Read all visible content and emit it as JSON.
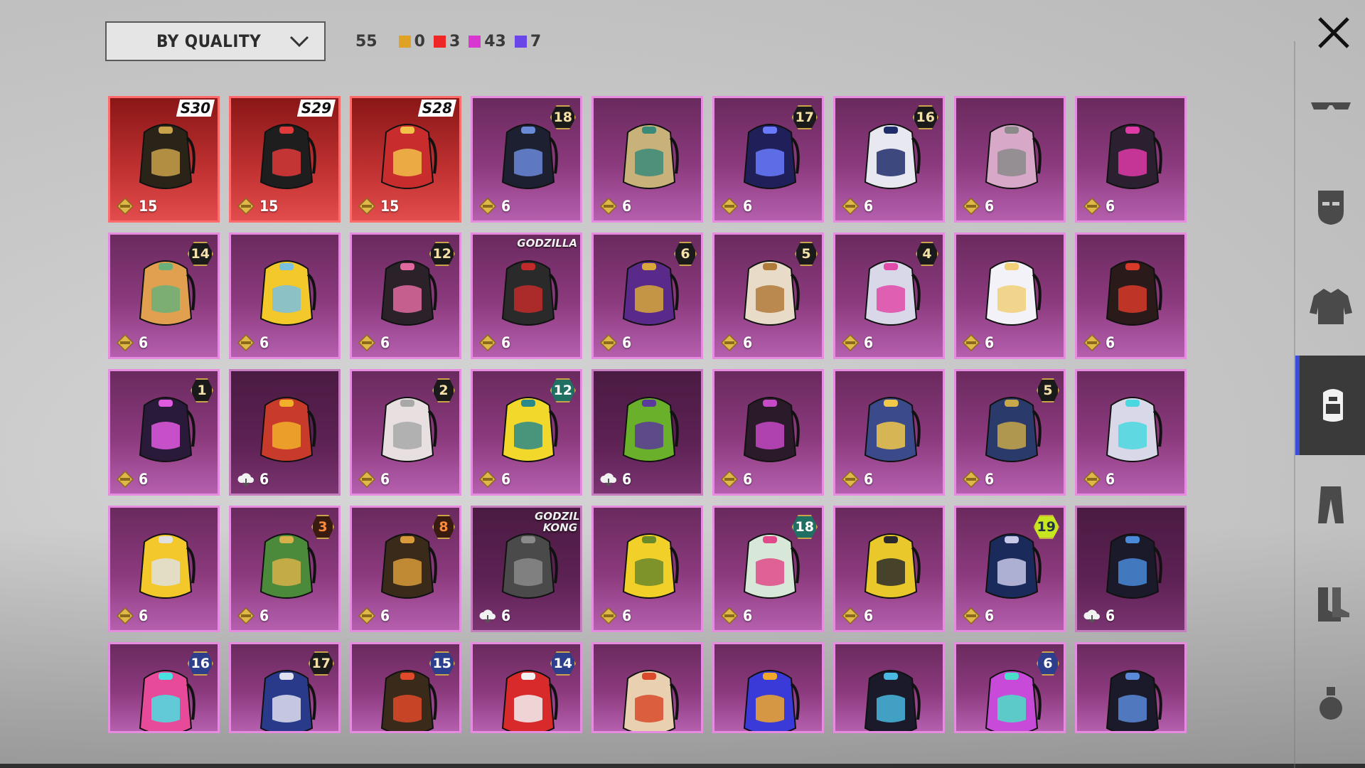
{
  "header": {
    "sort_label": "BY QUALITY",
    "total_count": "55",
    "counts": [
      {
        "color": "#e0a224",
        "value": "0"
      },
      {
        "color": "#ee2626",
        "value": "3"
      },
      {
        "color": "#d837d0",
        "value": "43"
      },
      {
        "color": "#6a46e8",
        "value": "7"
      }
    ]
  },
  "rail": {
    "categories": [
      "glasses-icon",
      "mask-icon",
      "jacket-icon",
      "backpack-icon",
      "pants-icon",
      "boots-icon",
      "grenade-icon"
    ],
    "active": "backpack-icon"
  },
  "items": [
    {
      "price": "15",
      "rarity": "red",
      "season": "S30",
      "color": "#2a2418",
      "accent": "#c9a14a",
      "currency": "diamond"
    },
    {
      "price": "15",
      "rarity": "red",
      "season": "S29",
      "color": "#1e1e1e",
      "accent": "#e03a3a",
      "currency": "diamond"
    },
    {
      "price": "15",
      "rarity": "red",
      "season": "S28",
      "color": "#c82c2c",
      "accent": "#f2c14a",
      "currency": "diamond"
    },
    {
      "price": "6",
      "rarity": "purple",
      "badge": "18",
      "color": "#1d2030",
      "accent": "#6a8ad8",
      "currency": "diamond"
    },
    {
      "price": "6",
      "rarity": "purple",
      "color": "#c8b27a",
      "accent": "#3a8a7a",
      "currency": "diamond"
    },
    {
      "price": "6",
      "rarity": "purple",
      "badge": "17",
      "color": "#1f1f5a",
      "accent": "#6a7aff",
      "currency": "diamond"
    },
    {
      "price": "6",
      "rarity": "purple",
      "badge": "16",
      "color": "#e8e8f0",
      "accent": "#1e2c6a",
      "currency": "diamond"
    },
    {
      "price": "6",
      "rarity": "purple",
      "color": "#d8a8c8",
      "accent": "#8a8a8a",
      "currency": "diamond"
    },
    {
      "price": "6",
      "rarity": "purple",
      "color": "#2a2030",
      "accent": "#e03aa8",
      "currency": "diamond"
    },
    {
      "price": "6",
      "rarity": "purple",
      "badge": "14",
      "color": "#e0a050",
      "accent": "#6ab07a",
      "currency": "diamond"
    },
    {
      "price": "6",
      "rarity": "purple",
      "color": "#f2c82a",
      "accent": "#7ac0e0",
      "currency": "diamond"
    },
    {
      "price": "6",
      "rarity": "purple",
      "badge": "12",
      "color": "#2a2228",
      "accent": "#e06aa0",
      "currency": "diamond"
    },
    {
      "price": "6",
      "rarity": "purple",
      "brand": "GODZILLA",
      "color": "#2a2a2a",
      "accent": "#c22a2a",
      "currency": "diamond"
    },
    {
      "price": "6",
      "rarity": "purple",
      "badge": "6",
      "color": "#5a2a8a",
      "accent": "#d8a83a",
      "currency": "diamond"
    },
    {
      "price": "6",
      "rarity": "purple",
      "badge": "5",
      "color": "#e8dcc8",
      "accent": "#b07a3a",
      "currency": "diamond"
    },
    {
      "price": "6",
      "rarity": "purple",
      "badge": "4",
      "color": "#d8d8e8",
      "accent": "#e04aa8",
      "currency": "diamond"
    },
    {
      "price": "6",
      "rarity": "purple",
      "color": "#f2f2f8",
      "accent": "#f2d07a",
      "currency": "diamond"
    },
    {
      "price": "6",
      "rarity": "purple",
      "color": "#2a1a1a",
      "accent": "#d83a2a",
      "currency": "diamond"
    },
    {
      "price": "6",
      "rarity": "purple",
      "badge": "1",
      "color": "#2a1a3a",
      "accent": "#e05ae0",
      "currency": "diamond"
    },
    {
      "price": "6",
      "rarity": "dim",
      "color": "#c83a2a",
      "accent": "#f2b02a",
      "currency": "cloud"
    },
    {
      "price": "6",
      "rarity": "purple",
      "badge": "2",
      "color": "#e8e0e0",
      "accent": "#a8a8a8",
      "currency": "diamond"
    },
    {
      "price": "6",
      "rarity": "purple",
      "badge": "12",
      "badge_style": "teal",
      "color": "#f2d82a",
      "accent": "#2a8a8a",
      "currency": "diamond"
    },
    {
      "price": "6",
      "rarity": "dim",
      "color": "#6ab02a",
      "accent": "#5a3a9a",
      "currency": "cloud"
    },
    {
      "price": "6",
      "rarity": "purple",
      "color": "#2a1a2a",
      "accent": "#c84ac8",
      "currency": "diamond"
    },
    {
      "price": "6",
      "rarity": "purple",
      "color": "#3a4a8a",
      "accent": "#f2c84a",
      "currency": "diamond"
    },
    {
      "price": "6",
      "rarity": "purple",
      "badge": "5",
      "color": "#2a3a6a",
      "accent": "#c8a84a",
      "currency": "diamond"
    },
    {
      "price": "6",
      "rarity": "purple",
      "color": "#d8d8e8",
      "accent": "#4ad8e0",
      "currency": "diamond"
    },
    {
      "price": "6",
      "rarity": "purple",
      "color": "#f2c82a",
      "accent": "#e0e0e0",
      "currency": "diamond"
    },
    {
      "price": "6",
      "rarity": "purple",
      "badge": "3",
      "badge_style": "orange",
      "color": "#4a8a3a",
      "accent": "#d8b04a",
      "currency": "diamond"
    },
    {
      "price": "6",
      "rarity": "purple",
      "badge": "8",
      "badge_style": "orange",
      "color": "#3a2a1a",
      "accent": "#d89a3a",
      "currency": "diamond"
    },
    {
      "price": "6",
      "rarity": "dim",
      "brand": "GODZILLA KONG",
      "color": "#4a4a4a",
      "accent": "#8a8a8a",
      "currency": "cloud"
    },
    {
      "price": "6",
      "rarity": "purple",
      "color": "#f2d02a",
      "accent": "#6a8a2a",
      "currency": "diamond"
    },
    {
      "price": "6",
      "rarity": "purple",
      "badge": "18",
      "badge_style": "teal",
      "color": "#d8e8d8",
      "accent": "#e04a8a",
      "currency": "diamond"
    },
    {
      "price": "6",
      "rarity": "purple",
      "color": "#e8c82a",
      "accent": "#2a2a2a",
      "currency": "diamond"
    },
    {
      "price": "6",
      "rarity": "purple",
      "badge": "19",
      "badge_style": "lime",
      "color": "#1a2a5a",
      "accent": "#c8c8e8",
      "currency": "diamond"
    },
    {
      "price": "6",
      "rarity": "dim",
      "color": "#1a1a2a",
      "accent": "#4a8ad8",
      "currency": "cloud"
    },
    {
      "price": "",
      "rarity": "purple",
      "badge": "16",
      "badge_style": "blue",
      "color": "#e84a9a",
      "accent": "#4ae0e0",
      "currency": "none"
    },
    {
      "price": "",
      "rarity": "purple",
      "badge": "17",
      "color": "#2a3a8a",
      "accent": "#e0e0f0",
      "currency": "none"
    },
    {
      "price": "",
      "rarity": "purple",
      "badge": "15",
      "badge_style": "blue",
      "color": "#3a2a1a",
      "accent": "#e04a2a",
      "currency": "none"
    },
    {
      "price": "",
      "rarity": "purple",
      "badge": "14",
      "badge_style": "blue",
      "color": "#d82a2a",
      "accent": "#f2f2f2",
      "currency": "none"
    },
    {
      "price": "",
      "rarity": "purple",
      "color": "#e8d0b0",
      "accent": "#d84a2a",
      "currency": "none"
    },
    {
      "price": "",
      "rarity": "purple",
      "color": "#3a3ad8",
      "accent": "#f2a82a",
      "currency": "none"
    },
    {
      "price": "",
      "rarity": "purple",
      "color": "#1a1a2a",
      "accent": "#4ab8e0",
      "currency": "none"
    },
    {
      "price": "",
      "rarity": "purple",
      "badge": "6",
      "badge_style": "blue",
      "color": "#c84ad8",
      "accent": "#4ae0c8",
      "currency": "none"
    },
    {
      "price": "",
      "rarity": "purple",
      "color": "#1a1a2a",
      "accent": "#5a8ad8",
      "currency": "none"
    }
  ]
}
